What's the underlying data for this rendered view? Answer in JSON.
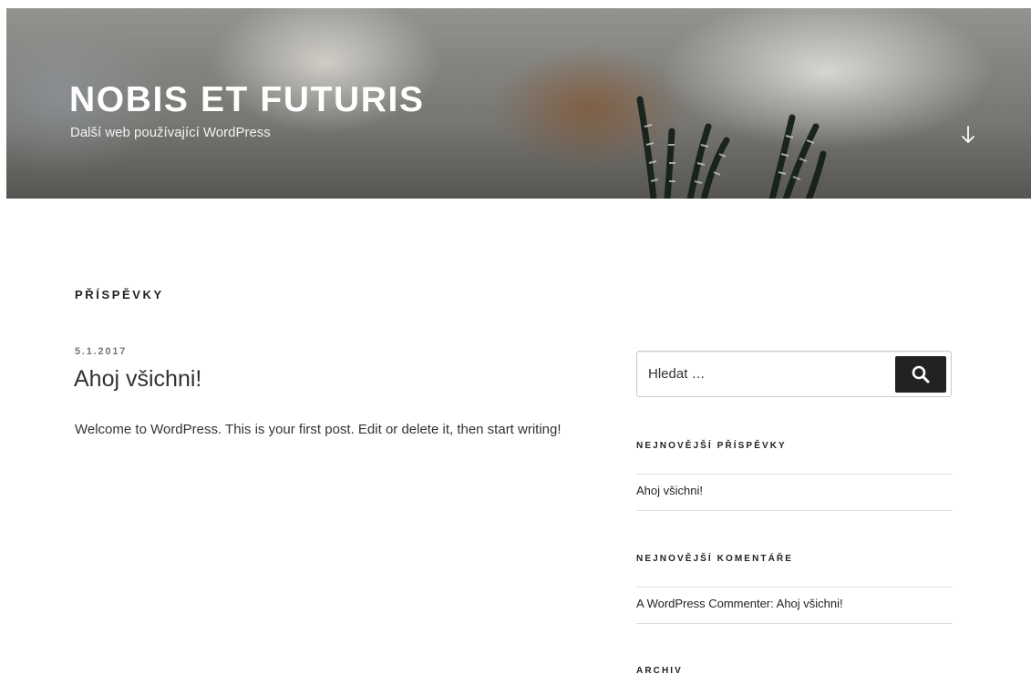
{
  "header": {
    "site_title": "NOBIS ET FUTURIS",
    "site_description": "Další web používající WordPress",
    "scroll_icon": "arrow-down-icon"
  },
  "main": {
    "section_heading": "PŘÍSPĚVKY",
    "post": {
      "date": "5.1.2017",
      "title": "Ahoj všichni!",
      "body": "Welcome to WordPress. This is your first post. Edit or delete it, then start writing!"
    }
  },
  "sidebar": {
    "search": {
      "placeholder": "Hledat …",
      "button_icon": "search-icon"
    },
    "recent_posts": {
      "title": "NEJNOVĚJŠÍ PŘÍSPĚVKY",
      "items": [
        "Ahoj všichni!"
      ]
    },
    "recent_comments": {
      "title": "NEJNOVĚJŠÍ KOMENTÁŘE",
      "items": [
        "A WordPress Commenter: Ahoj všichni!"
      ]
    },
    "archive": {
      "title": "ARCHIV"
    }
  },
  "colors": {
    "text": "#333333",
    "heading": "#222222",
    "search_button": "#222222",
    "header_text": "#ffffff"
  }
}
